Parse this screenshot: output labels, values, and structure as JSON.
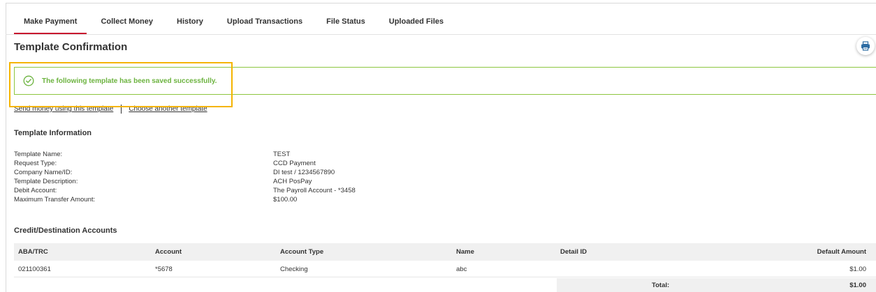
{
  "tabs": [
    {
      "label": "Make Payment",
      "active": true
    },
    {
      "label": "Collect Money",
      "active": false
    },
    {
      "label": "History",
      "active": false
    },
    {
      "label": "Upload Transactions",
      "active": false
    },
    {
      "label": "File Status",
      "active": false
    },
    {
      "label": "Uploaded Files",
      "active": false
    }
  ],
  "page_title": "Template Confirmation",
  "print_icon": "printer-icon",
  "success": {
    "icon": "check-circle-icon",
    "message": "The following template has been saved successfully.",
    "color": "#6cb33f",
    "border_color": "#8dc63f"
  },
  "highlight_color": "#f5b400",
  "accent_color": "#c8102e",
  "links": {
    "send_money": "Send money using this template",
    "choose_another": "Choose another template"
  },
  "template_info": {
    "title": "Template Information",
    "rows": [
      {
        "label": "Template Name:",
        "value": "TEST"
      },
      {
        "label": "Request Type:",
        "value": "CCD Payment"
      },
      {
        "label": "Company Name/ID:",
        "value": "DI test / 1234567890"
      },
      {
        "label": "Template Description:",
        "value": "ACH PosPay"
      },
      {
        "label": "Debit Account:",
        "value": "The Payroll Account - *3458"
      },
      {
        "label": "Maximum Transfer Amount:",
        "value": "$100.00"
      }
    ]
  },
  "credit_accounts": {
    "title": "Credit/Destination Accounts",
    "columns": {
      "aba": "ABA/TRC",
      "account": "Account",
      "account_type": "Account Type",
      "name": "Name",
      "detail_id": "Detail ID",
      "default_amount": "Default Amount"
    },
    "rows": [
      {
        "aba": "021100361",
        "account": "*5678",
        "account_type": "Checking",
        "name": "abc",
        "detail_id": "",
        "default_amount": "$1.00"
      }
    ],
    "total_label": "Total:",
    "total_value": "$1.00"
  }
}
